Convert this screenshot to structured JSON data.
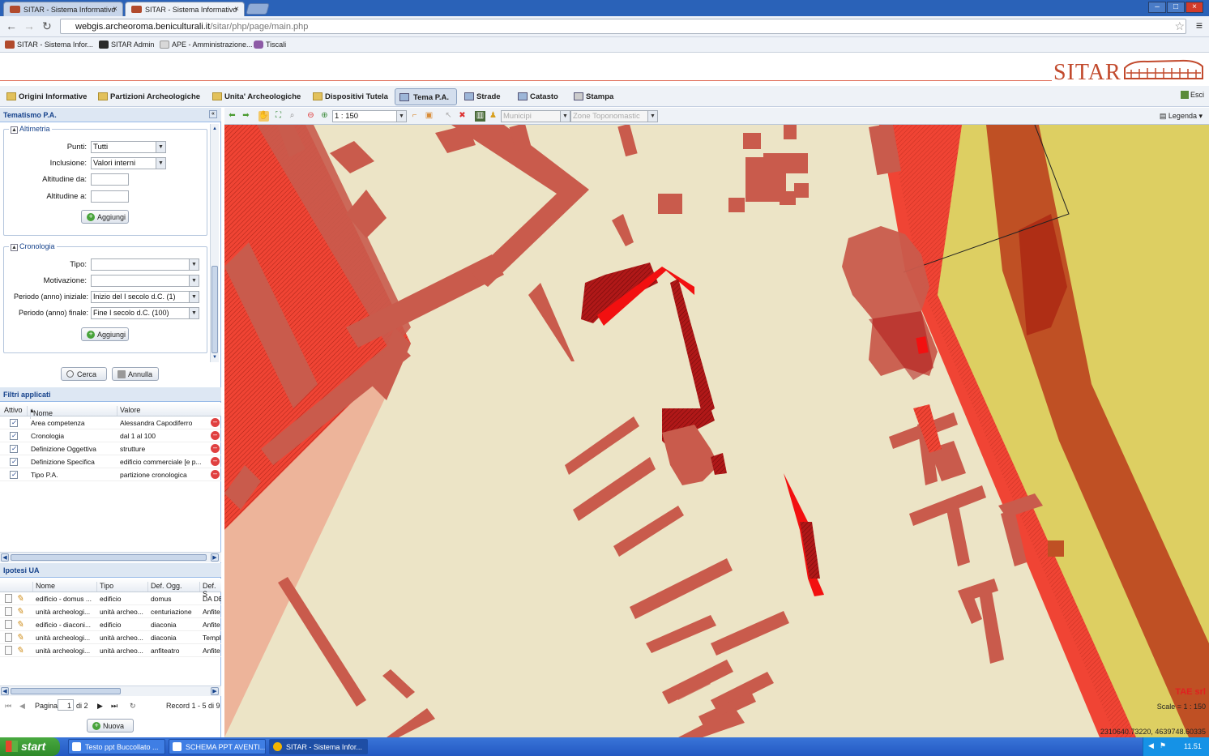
{
  "browser": {
    "tabs": [
      {
        "label": "SITAR - Sistema Informativo"
      },
      {
        "label": "SITAR - Sistema Informativo"
      }
    ],
    "url_host": "webgis.archeoroma.beniculturali.it",
    "url_path": "/sitar/php/page/main.php",
    "bookmarks": [
      "SITAR - Sistema Infor...",
      "SITAR Admin",
      "APE - Amministrazione...",
      "Tiscali"
    ]
  },
  "header": {
    "logo": "SITAR"
  },
  "menu": {
    "items": [
      "Origini Informative",
      "Partizioni Archeologiche",
      "Unita' Archeologiche",
      "Dispositivi Tutela",
      "Tema P.A.",
      "Strade",
      "Catasto",
      "Stampa"
    ],
    "selected": "Tema P.A.",
    "exit": "Esci"
  },
  "left": {
    "title": "Tematismo P.A.",
    "altimetria": {
      "legend": "Altimetria",
      "punti_label": "Punti:",
      "punti_value": "Tutti",
      "inclusione_label": "Inclusione:",
      "inclusione_value": "Valori interni",
      "alt_da_label": "Altitudine da:",
      "alt_a_label": "Altitudine a:",
      "add": "Aggiungi"
    },
    "cronologia": {
      "legend": "Cronologia",
      "tipo_label": "Tipo:",
      "motivazione_label": "Motivazione:",
      "inizio_label": "Periodo (anno) iniziale:",
      "inizio_value": "Inizio del I secolo d.C. (1)",
      "fine_label": "Periodo (anno) finale:",
      "fine_value": "Fine I secolo d.C. (100)",
      "add": "Aggiungi"
    },
    "search": "Cerca",
    "cancel": "Annulla",
    "filters": {
      "title": "Filtri applicati",
      "headers": [
        "Attivo",
        "Nome",
        "Valore"
      ],
      "rows": [
        {
          "name": "Area competenza",
          "value": "Alessandra Capodiferro"
        },
        {
          "name": "Cronologia",
          "value": "dal 1 al 100"
        },
        {
          "name": "Definizione Oggettiva",
          "value": "strutture"
        },
        {
          "name": "Definizione Specifica",
          "value": "edificio commerciale [e p..."
        },
        {
          "name": "Tipo P.A.",
          "value": "partizione cronologica"
        }
      ]
    },
    "ipotesi": {
      "title": "Ipotesi UA",
      "headers": [
        "Nome",
        "Tipo",
        "Def. Ogg.",
        "Def. S"
      ],
      "rows": [
        [
          "edificio - domus ...",
          "edificio",
          "domus",
          "DA DE"
        ],
        [
          "unità archeologi...",
          "unità archeo...",
          "centuriazione",
          "Anfite"
        ],
        [
          "edificio - diaconi...",
          "edificio",
          "diaconia",
          "Anfite"
        ],
        [
          "unità archeologi...",
          "unità archeo...",
          "diaconia",
          "Templ"
        ],
        [
          "unità archeologi...",
          "unità archeo...",
          "anfiteatro",
          "Anfite"
        ]
      ]
    },
    "pager": {
      "page_label": "Pagina",
      "page": "1",
      "of": "di 2",
      "records": "Record 1 - 5 di 9"
    },
    "new": "Nuova"
  },
  "maptoolbar": {
    "scale": "1 : 150",
    "municipi": "Municipi",
    "zone": "Zone Toponomastic",
    "legend": "Legenda"
  },
  "map": {
    "credit": "TAE srl",
    "scale": "Scale = 1 : 150",
    "coords": "2310640.73220, 4639748.60335"
  },
  "colors": {
    "plan": "#ece4c6",
    "red_area": "#f04434",
    "building": "#c95b4c",
    "dark_red": "#b01818",
    "bright_red": "#f21010",
    "yellow": "#ddcf62",
    "brown": "#bf5024"
  },
  "taskbar": {
    "start": "start",
    "tasks": [
      "Testo ppt Buccollato ...",
      "SCHEMA PPT AVENTI...",
      "SITAR - Sistema Infor..."
    ],
    "clock": "11.51"
  }
}
